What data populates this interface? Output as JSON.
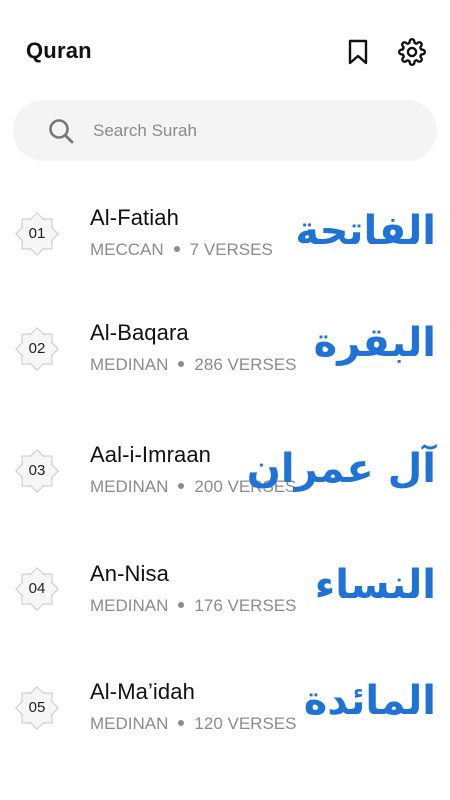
{
  "header": {
    "title": "Quran",
    "bookmark_icon": "bookmark-icon",
    "settings_icon": "gear-icon"
  },
  "search": {
    "placeholder": "Search Surah",
    "value": "",
    "icon": "search-icon"
  },
  "colors": {
    "accent": "#1f73d6",
    "search_bg": "#f4f4f4",
    "muted_text": "#8c8c8c"
  },
  "surahs": [
    {
      "number": "01",
      "name": "Al-Fatiah",
      "type": "MECCAN",
      "verses": "7 VERSES",
      "arabic": "الفاتحة"
    },
    {
      "number": "02",
      "name": "Al-Baqara",
      "type": "MEDINAN",
      "verses": "286 VERSES",
      "arabic": "البقرة"
    },
    {
      "number": "03",
      "name": "Aal-i-Imraan",
      "type": "MEDINAN",
      "verses": "200 VERSES",
      "arabic": "آل عمران"
    },
    {
      "number": "04",
      "name": "An-Nisa",
      "type": "MEDINAN",
      "verses": "176 VERSES",
      "arabic": "النساء"
    },
    {
      "number": "05",
      "name": "Al-Ma’idah",
      "type": "MEDINAN",
      "verses": "120 VERSES",
      "arabic": "المائدة"
    }
  ]
}
